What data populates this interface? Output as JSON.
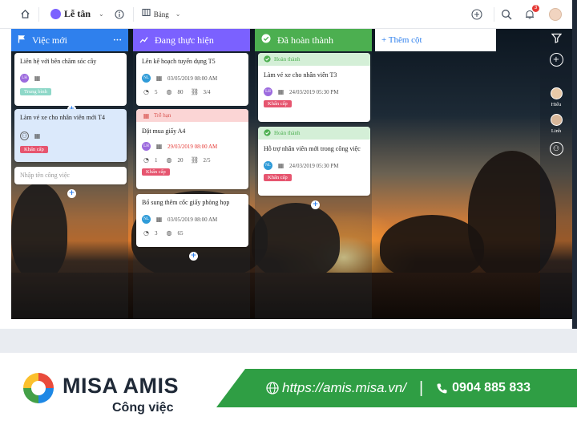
{
  "topbar": {
    "home_icon": "home-icon",
    "workspace": "Lễ tân",
    "view": "Bảng",
    "notifications_count": "3"
  },
  "columns": [
    {
      "title": "Việc mới",
      "color": "#2f80ed",
      "more": "···",
      "add": "+",
      "quick_add_placeholder": "Nhập tên công việc",
      "cards": [
        {
          "title": "Liên hệ với bên chăm sóc cây",
          "avatar": "LH",
          "tag": "Trung bình"
        },
        {
          "title": "Làm vé xe cho nhân viên mới T4",
          "tag": "Khẩn cấp"
        }
      ]
    },
    {
      "title": "Đang thực hiện",
      "color": "#7b61ff",
      "add": "+",
      "cards": [
        {
          "title": "Lên kế hoạch tuyển dụng T5",
          "avatar": "NL",
          "date": "03/05/2019 08:00 AM",
          "comments": "5",
          "watchers": "80",
          "subtasks": "3/4"
        },
        {
          "status": "Trễ hạn",
          "title": "Đặt mua giấy A4",
          "avatar": "LH",
          "date": "29/03/2019 08:00 AM",
          "comments": "1",
          "watchers": "20",
          "subtasks": "2/5",
          "tag": "Khẩn cấp"
        },
        {
          "title": "Bổ sung thêm cốc giấy phòng họp",
          "avatar": "NL",
          "date": "03/05/2019 08:00 AM",
          "comments": "3",
          "watchers": "65"
        }
      ]
    },
    {
      "title": "Đã hoàn thành",
      "color": "#4caf50",
      "add": "+",
      "cards": [
        {
          "status": "Hoàn thành",
          "title": "Làm vé xe cho nhân viên T3",
          "avatar": "LH",
          "date": "24/03/2019 05:30 PM",
          "tag": "Khẩn cấp"
        },
        {
          "status": "Hoàn thành",
          "title": "Hỗ trợ nhân viên mới trong công việc",
          "avatar": "NL",
          "date": "24/03/2019 05:30 PM",
          "tag": "Khẩn cấp"
        }
      ]
    }
  ],
  "add_column": "+ Thêm cột",
  "rightbar": {
    "user1": "Hiếu",
    "user2": "Linh"
  },
  "footer": {
    "brand": "MISA AMIS",
    "product": "Công việc",
    "url": "https://amis.misa.vn/",
    "divider": "|",
    "phone": "0904 885 833",
    "green": "#2f9e44"
  }
}
